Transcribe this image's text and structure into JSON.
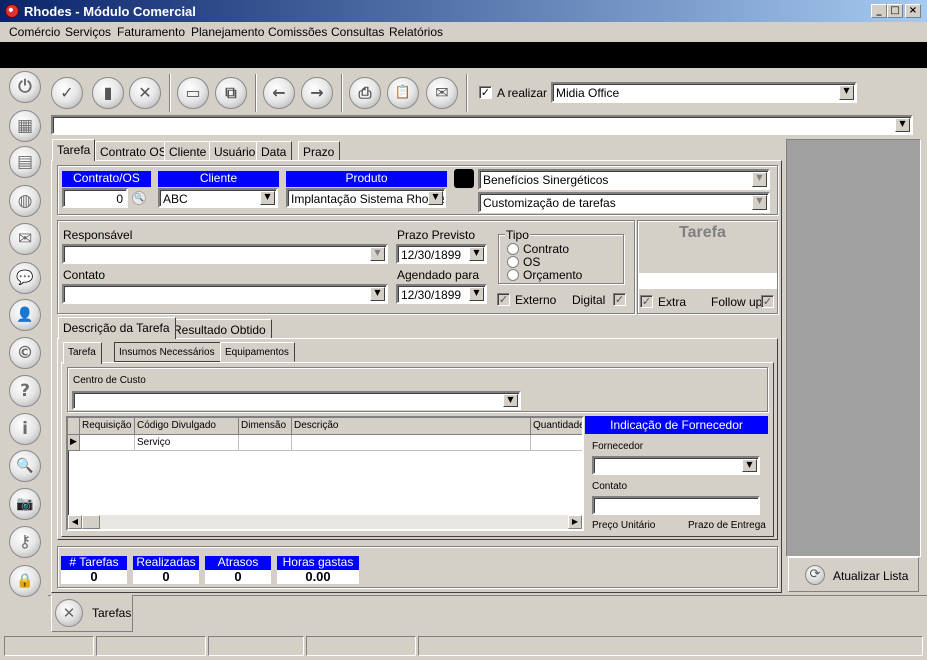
{
  "window": {
    "title": "Rhodes - Módulo Comercial",
    "min": "_",
    "max": "□",
    "close": "×"
  },
  "menu": [
    "Comércio",
    "Serviços",
    "Faturamento",
    "Planejamento",
    "Comissões",
    "Consultas",
    "Relatórios"
  ],
  "sidebar": [
    {
      "icon": "power-icon",
      "glyph": "⏻"
    },
    {
      "icon": "calculator-icon",
      "glyph": "▦"
    },
    {
      "icon": "calendar-icon",
      "glyph": "▤"
    },
    {
      "icon": "globe-icon",
      "glyph": "◍"
    },
    {
      "icon": "mail-icon",
      "glyph": "✉"
    },
    {
      "icon": "chat-icon",
      "glyph": "💬"
    },
    {
      "icon": "user-icon",
      "glyph": "👤"
    },
    {
      "icon": "copyright-icon",
      "glyph": "©"
    },
    {
      "icon": "help-icon",
      "glyph": "?"
    },
    {
      "icon": "info-icon",
      "glyph": "i"
    },
    {
      "icon": "search-icon",
      "glyph": "🔍"
    },
    {
      "icon": "camera-icon",
      "glyph": "📷"
    },
    {
      "icon": "key-icon",
      "glyph": "⚷"
    },
    {
      "icon": "lock-icon",
      "glyph": "🔒"
    }
  ],
  "toolbar": {
    "buttons": [
      {
        "icon": "check-icon",
        "glyph": "✓"
      },
      {
        "icon": "document-icon",
        "glyph": "▮"
      },
      {
        "icon": "cancel-icon",
        "glyph": "✕"
      },
      {
        "icon": "window-icon",
        "glyph": "▭"
      },
      {
        "icon": "windows-icon",
        "glyph": "⧉"
      },
      {
        "icon": "arrow-left-icon",
        "glyph": "←"
      },
      {
        "icon": "arrow-right-icon",
        "glyph": "→"
      },
      {
        "icon": "printer-icon",
        "glyph": "⎙"
      },
      {
        "icon": "clipboard-icon",
        "glyph": "📋"
      },
      {
        "icon": "email-icon",
        "glyph": "✉"
      }
    ],
    "a_realizar_label": "A realizar",
    "a_realizar_checked": "✓",
    "company_value": "Midia Office"
  },
  "tabs": [
    "Tarefa",
    "Contrato OS",
    "Cliente",
    "Usuário",
    "Data",
    "Prazo"
  ],
  "form": {
    "contrato_label": "Contrato/OS",
    "contrato_value": "0",
    "cliente_label": "Cliente",
    "cliente_value": "ABC",
    "produto_label": "Produto",
    "produto_value": "Implantação Sistema Rhodes",
    "beneficios_value": "Benefícios Sinergéticos",
    "customizacao_value": "Customização de tarefas",
    "responsavel_label": "Responsável",
    "contato_label": "Contato",
    "prazo_label": "Prazo Previsto",
    "prazo_value": "12/30/1899",
    "agendado_label": "Agendado para",
    "agendado_value": "12/30/1899",
    "tipo_label": "Tipo",
    "tipo_options": [
      "Contrato",
      "OS",
      "Orçamento"
    ],
    "externo_label": "Externo",
    "digital_label": "Digital",
    "tarefa_title": "Tarefa",
    "extra_label": "Extra",
    "followup_label": "Follow up",
    "check_mark": "✓"
  },
  "inner_tabs": [
    "Descrição da Tarefa",
    "Resultado Obtido"
  ],
  "sub_tabs": [
    "Tarefa",
    "Insumos Necessários",
    "Equipamentos"
  ],
  "centro_custo_label": "Centro de Custo",
  "grid": {
    "columns": [
      "Requisição",
      "Código Divulgado",
      "Dimensão",
      "Descrição",
      "Quantidade"
    ],
    "rows": [
      [
        "",
        "Serviço",
        "",
        "",
        ""
      ]
    ]
  },
  "fornecedor": {
    "header": "Indicação de Fornecedor",
    "fornecedor_label": "Fornecedor",
    "contato_label": "Contato",
    "preco_label": "Preço Unitário",
    "prazo_label": "Prazo de Entrega"
  },
  "stats": [
    {
      "label": "# Tarefas",
      "value": "0"
    },
    {
      "label": "Realizadas",
      "value": "0"
    },
    {
      "label": "Atrasos",
      "value": "0"
    },
    {
      "label": "Horas gastas",
      "value": "0.00"
    }
  ],
  "atualizar_label": "Atualizar Lista",
  "bottom_tab_label": "Tarefas"
}
